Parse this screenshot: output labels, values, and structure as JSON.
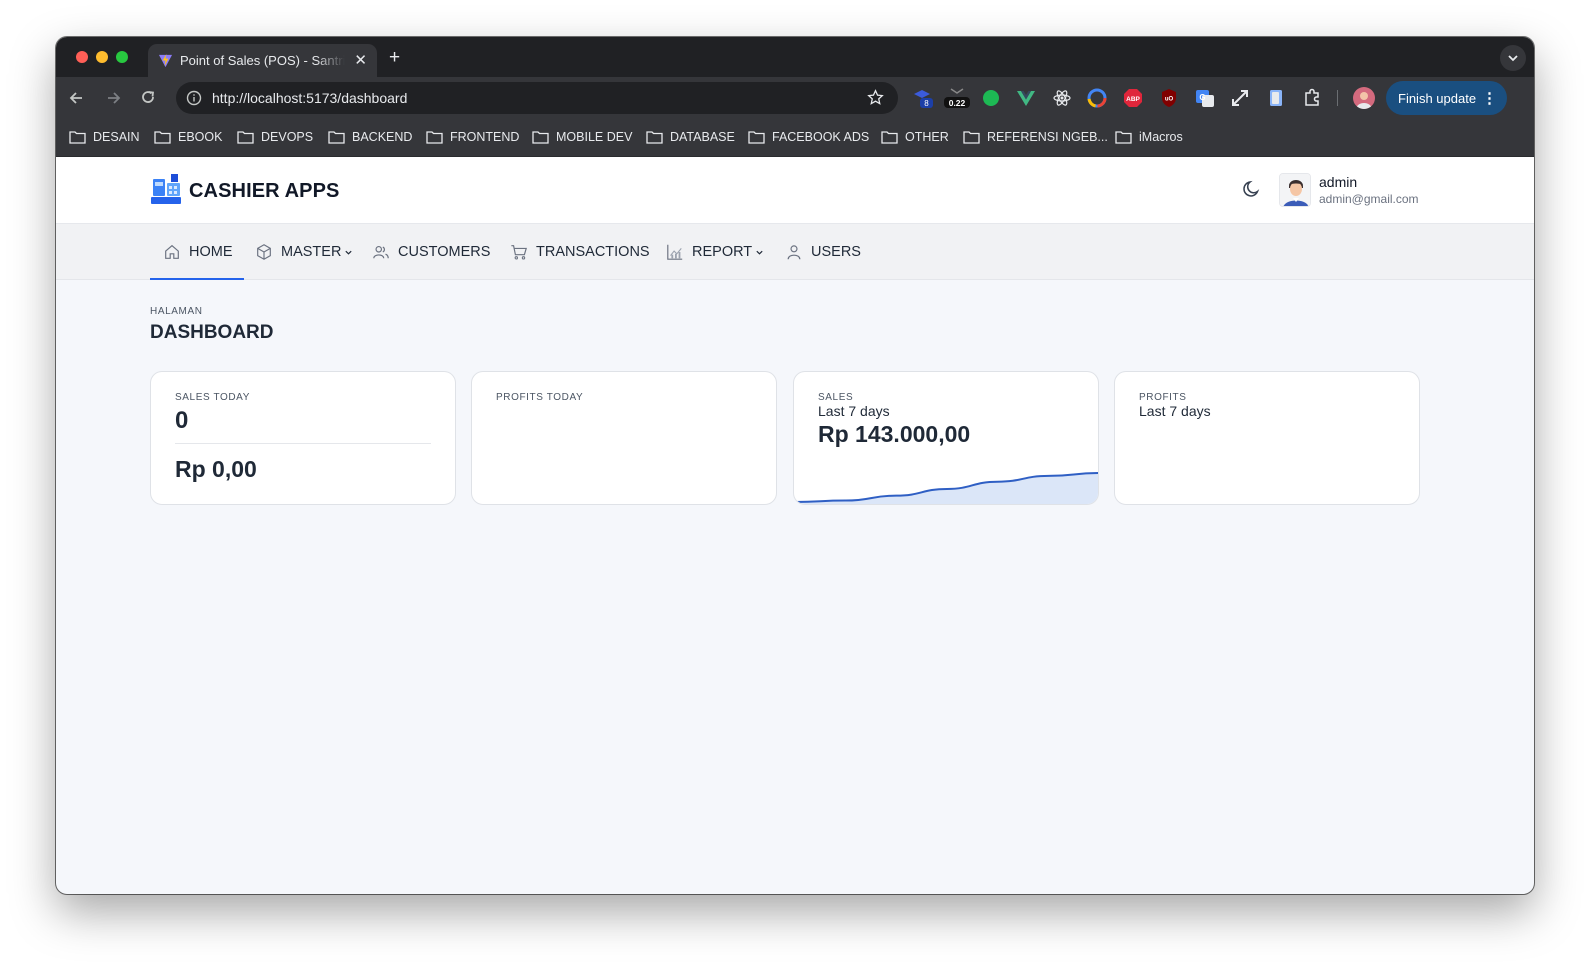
{
  "browser": {
    "tab_title": "Point of Sales (POS) - SantriKoding",
    "url": "http://localhost:5173/dashboard",
    "finish_update_label": "Finish update",
    "extension_badges": {
      "badge_8": "8",
      "badge_022": "0.22",
      "abp": "ABP",
      "ublock": "uO"
    },
    "bookmarks": [
      "DESAIN",
      "EBOOK",
      "DEVOPS",
      "BACKEND",
      "FRONTEND",
      "MOBILE DEV",
      "DATABASE",
      "FACEBOOK ADS",
      "OTHER",
      "REFERENSI NGEB...",
      "iMacros"
    ]
  },
  "app": {
    "brand": "CASHIER APPS",
    "user": {
      "name": "admin",
      "email": "admin@gmail.com"
    },
    "nav": [
      {
        "label": "HOME",
        "icon": "home-icon",
        "active": true
      },
      {
        "label": "MASTER",
        "icon": "cube-icon",
        "dropdown": true
      },
      {
        "label": "CUSTOMERS",
        "icon": "users-icon"
      },
      {
        "label": "TRANSACTIONS",
        "icon": "cart-icon"
      },
      {
        "label": "REPORT",
        "icon": "chart-icon",
        "dropdown": true
      },
      {
        "label": "USERS",
        "icon": "user-icon"
      }
    ]
  },
  "page": {
    "subtitle": "HALAMAN",
    "title": "DASHBOARD"
  },
  "cards": {
    "sales_today": {
      "label": "SALES TODAY",
      "count": "0",
      "amount": "Rp 0,00"
    },
    "profits_today": {
      "label": "PROFITS TODAY"
    },
    "sales": {
      "label": "SALES",
      "period": "Last 7 days",
      "amount": "Rp 143.000,00",
      "trend": [
        0.0,
        0.05,
        0.22,
        0.45,
        0.7,
        0.9,
        1.0
      ]
    },
    "profits": {
      "label": "PROFITS",
      "period": "Last 7 days"
    }
  },
  "colors": {
    "accent": "#2563eb",
    "chart_fill": "#dbe6f8",
    "chart_line": "#2f5fc4"
  }
}
